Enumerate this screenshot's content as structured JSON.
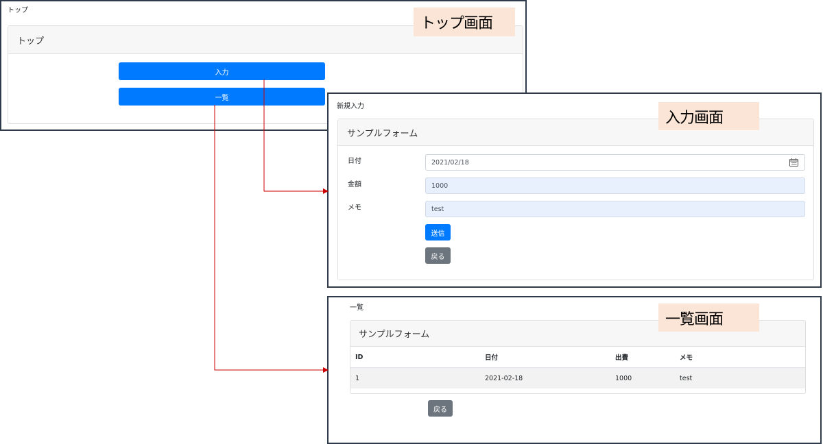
{
  "top_screen": {
    "title": "トップ",
    "caption": "トップ画面",
    "card_header": "トップ",
    "input_button": "入力",
    "list_button": "一覧"
  },
  "input_screen": {
    "title": "新規入力",
    "caption": "入力画面",
    "card_header": "サンプルフォーム",
    "date_label": "日付",
    "date_value": "2021/02/18",
    "amount_label": "金額",
    "amount_value": "1000",
    "memo_label": "メモ",
    "memo_value": "test",
    "submit_button": "送信",
    "back_button": "戻る"
  },
  "list_screen": {
    "title": "一覧",
    "caption": "一覧画面",
    "card_header": "サンプルフォーム",
    "columns": [
      "ID",
      "日付",
      "出費",
      "メモ"
    ],
    "rows": [
      [
        "1",
        "2021-02-18",
        "1000",
        "test"
      ]
    ],
    "back_button": "戻る"
  },
  "colors": {
    "primary": "#007bff",
    "secondary": "#6c757d",
    "caption_bg": "#fbe5d6",
    "arrow": "#cc0000",
    "frame": "#2f3a4a"
  },
  "icons": {
    "date_field": "calendar-icon"
  }
}
